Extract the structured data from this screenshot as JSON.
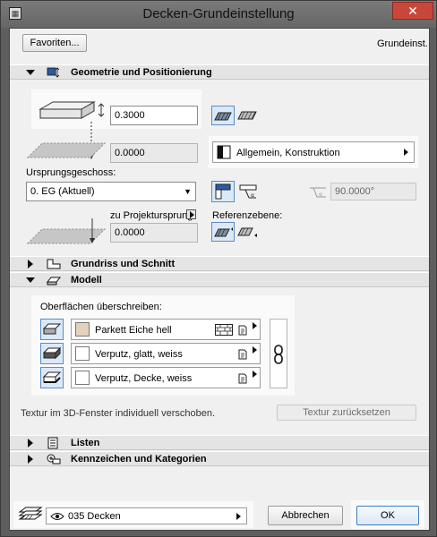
{
  "window": {
    "title": "Decken-Grundeinstellung",
    "close_glyph": "✕"
  },
  "toolbar": {
    "favorites_label": "Favoriten...",
    "mode_label": "Grundeinst."
  },
  "sections": {
    "geometry": "Geometrie und Positionierung",
    "floorplan": "Grundriss und Schnitt",
    "model": "Modell",
    "lists": "Listen",
    "tags": "Kennzeichen und Kategorien"
  },
  "geometry": {
    "thickness_value": "0.3000",
    "offset_value": "0.0000",
    "origin_floor_label": "Ursprungsgeschoss:",
    "origin_floor_value": "0. EG (Aktuell)",
    "project_origin_label": "zu Projektursprung",
    "project_origin_value": "0.0000",
    "building_material": "Allgemein, Konstruktion",
    "angle_value": "90.0000°",
    "reference_plane_label": "Referenzebene:"
  },
  "model": {
    "override_label": "Oberflächen überschreiben:",
    "surfaces": [
      {
        "name": "Parkett Eiche hell",
        "color": "#e2d2bd"
      },
      {
        "name": "Verputz, glatt, weiss",
        "color": "#ffffff"
      },
      {
        "name": "Verputz, Decke, weiss",
        "color": "#ffffff"
      }
    ],
    "texture_note": "Textur im 3D-Fenster individuell verschoben.",
    "texture_reset_label": "Textur zurücksetzen"
  },
  "footer": {
    "layer_value": "035 Decken",
    "cancel_label": "Abbrechen",
    "ok_label": "OK"
  },
  "colors": {
    "accent": "#5b8cc2",
    "highlight_panel": "#fafafa",
    "close_button": "#c9473a"
  }
}
